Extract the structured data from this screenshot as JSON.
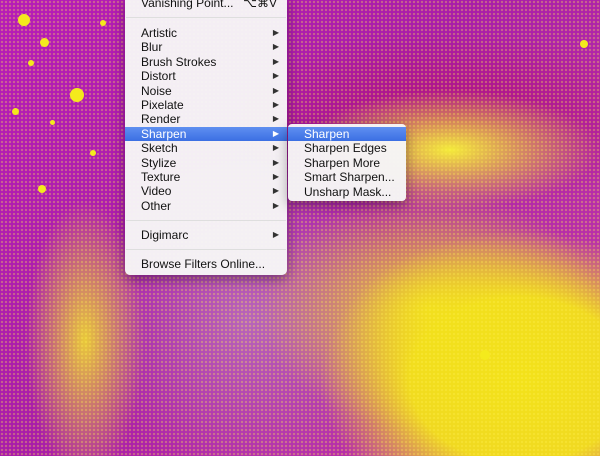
{
  "filter_menu": {
    "vanishing_point": {
      "label": "Vanishing Point...",
      "shortcut": "⌥⌘V"
    },
    "items": [
      {
        "label": "Artistic",
        "submenu": true
      },
      {
        "label": "Blur",
        "submenu": true
      },
      {
        "label": "Brush Strokes",
        "submenu": true
      },
      {
        "label": "Distort",
        "submenu": true
      },
      {
        "label": "Noise",
        "submenu": true
      },
      {
        "label": "Pixelate",
        "submenu": true
      },
      {
        "label": "Render",
        "submenu": true
      },
      {
        "label": "Sharpen",
        "submenu": true,
        "highlighted": true
      },
      {
        "label": "Sketch",
        "submenu": true
      },
      {
        "label": "Stylize",
        "submenu": true
      },
      {
        "label": "Texture",
        "submenu": true
      },
      {
        "label": "Video",
        "submenu": true
      },
      {
        "label": "Other",
        "submenu": true
      }
    ],
    "digimarc": {
      "label": "Digimarc",
      "submenu": true
    },
    "browse_online": {
      "label": "Browse Filters Online..."
    }
  },
  "sharpen_submenu": {
    "items": [
      {
        "label": "Sharpen",
        "highlighted": true
      },
      {
        "label": "Sharpen Edges"
      },
      {
        "label": "Sharpen More"
      },
      {
        "label": "Smart Sharpen..."
      },
      {
        "label": "Unsharp Mask..."
      }
    ]
  },
  "colors": {
    "highlight": "#3b6fe3",
    "magenta": "#b61bb8",
    "yellow": "#f4ea1c"
  }
}
